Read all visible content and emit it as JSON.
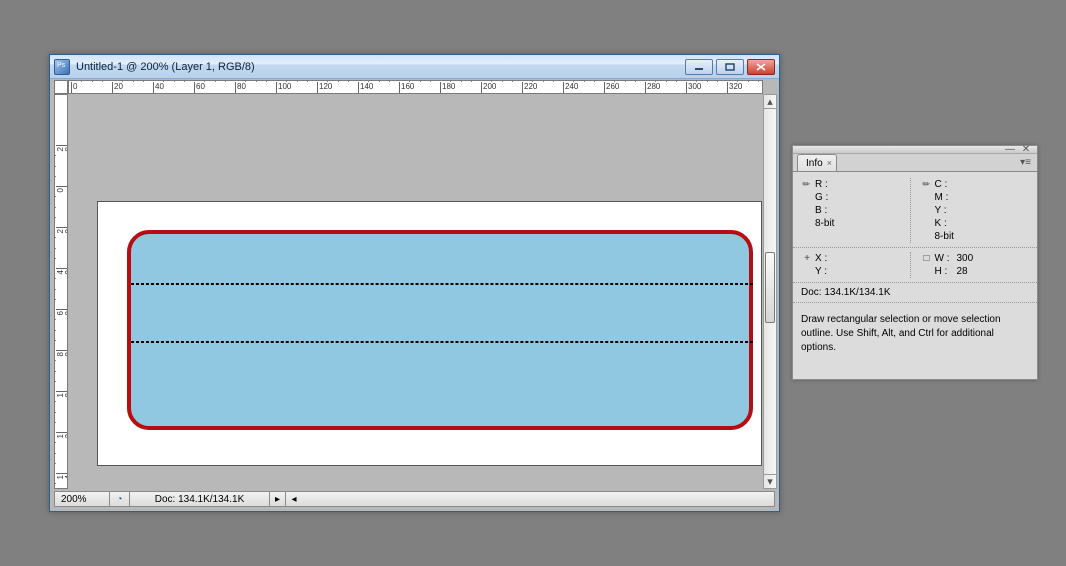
{
  "docWindow": {
    "title": "Untitled-1 @ 200% (Layer 1, RGB/8)"
  },
  "rulerH": {
    "labels": [
      "0",
      "20",
      "40",
      "60",
      "80",
      "100",
      "120",
      "140",
      "160",
      "180",
      "200",
      "220",
      "240",
      "260",
      "280",
      "300",
      "320"
    ]
  },
  "rulerV": {
    "labels": [
      "20",
      "0",
      "20",
      "40",
      "60",
      "80",
      "100",
      "120",
      "140"
    ]
  },
  "status": {
    "zoom": "200%",
    "docsize": "Doc: 134.1K/134.1K"
  },
  "infoPanel": {
    "tab": "Info",
    "rgb_r": "R :",
    "rgb_g": "G :",
    "rgb_b": "B :",
    "cmyk_c": "C :",
    "cmyk_m": "M :",
    "cmyk_y": "Y :",
    "cmyk_k": "K :",
    "bit_l": "8-bit",
    "bit_r": "8-bit",
    "x": "X :",
    "y": "Y :",
    "w_lbl": "W :",
    "h_lbl": "H :",
    "w_val": "300",
    "h_val": "28",
    "docstat": "Doc: 134.1K/134.1K",
    "hint": "Draw rectangular selection or move selection outline.  Use Shift, Alt, and Ctrl for additional options."
  }
}
